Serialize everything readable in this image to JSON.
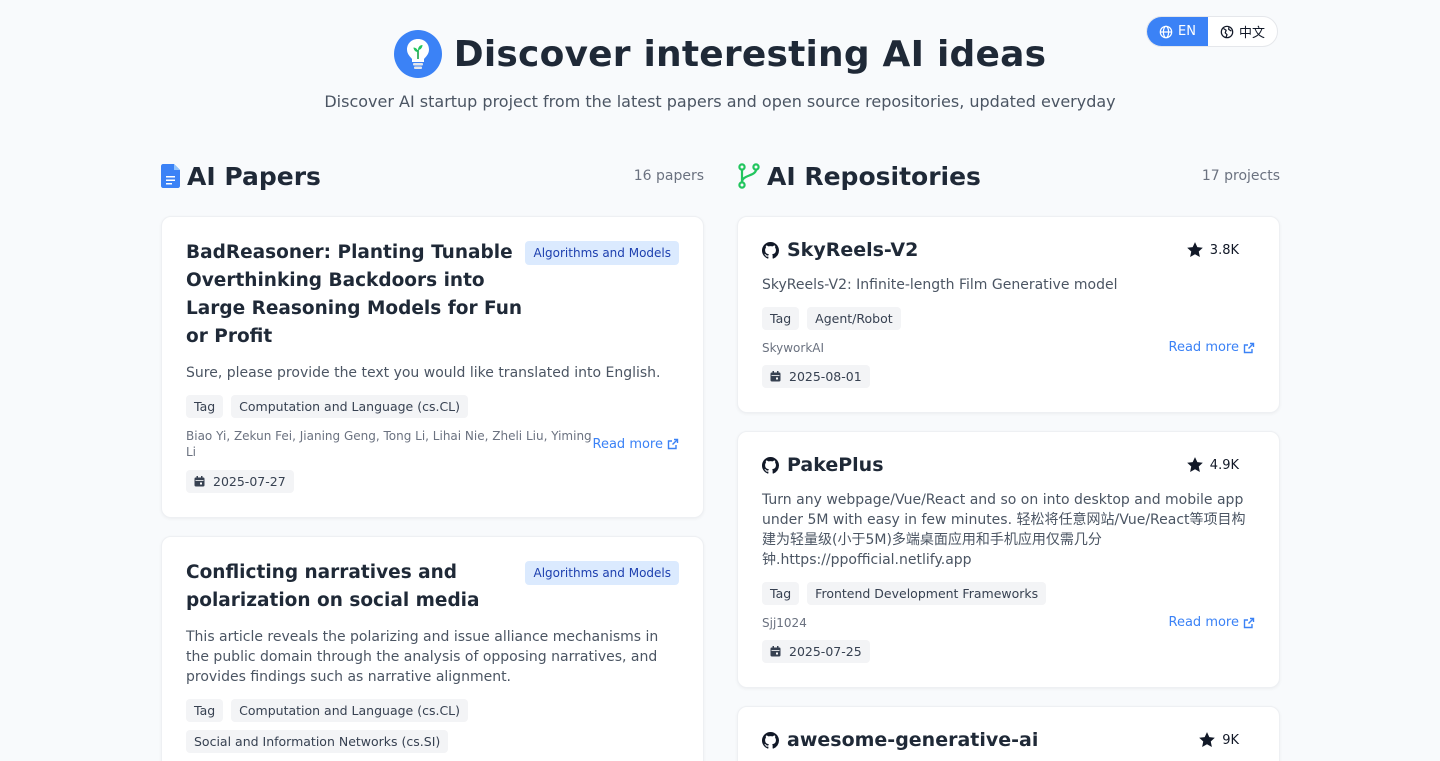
{
  "lang": {
    "en": "EN",
    "zh": "中文"
  },
  "hero": {
    "title": "Discover interesting AI ideas",
    "subtitle": "Discover AI startup project from the latest papers and open source repositories, updated everyday"
  },
  "papers": {
    "heading": "AI Papers",
    "count": "16 papers",
    "items": [
      {
        "title": "BadReasoner: Planting Tunable Overthinking Backdoors into Large Reasoning Models for Fun or Profit",
        "category": "Algorithms and Models",
        "description": "Sure, please provide the text you would like translated into English.",
        "tags": [
          "Tag",
          "Computation and Language (cs.CL)"
        ],
        "authors": "Biao Yi, Zekun Fei, Jianing Geng, Tong Li, Lihai Nie, Zheli Liu, Yiming Li",
        "read_more": "Read more",
        "date": "2025-07-27"
      },
      {
        "title": "Conflicting narratives and polarization on social media",
        "category": "Algorithms and Models",
        "description": "This article reveals the polarizing and issue alliance mechanisms in the public domain through the analysis of opposing narratives, and provides findings such as narrative alignment.",
        "tags": [
          "Tag",
          "Computation and Language (cs.CL)",
          "Social and Information Networks (cs.SI)"
        ]
      }
    ]
  },
  "repos": {
    "heading": "AI Repositories",
    "count": "17 projects",
    "items": [
      {
        "name": "SkyReels-V2",
        "stars": "3.8K",
        "description": "SkyReels-V2: Infinite-length Film Generative model",
        "tags": [
          "Tag",
          "Agent/Robot"
        ],
        "owner": "SkyworkAI",
        "read_more": "Read more",
        "date": "2025-08-01"
      },
      {
        "name": "PakePlus",
        "stars": "4.9K",
        "description": "Turn any webpage/Vue/React and so on into desktop and mobile app under 5M with easy in few minutes. 轻松将任意网站/Vue/React等项目构建为轻量级(小于5M)多端桌面应用和手机应用仅需几分钟.https://ppofficial.netlify.app",
        "tags": [
          "Tag",
          "Frontend Development Frameworks"
        ],
        "owner": "Sjj1024",
        "read_more": "Read more",
        "date": "2025-07-25"
      },
      {
        "name": "awesome-generative-ai",
        "stars": "9K"
      }
    ]
  },
  "colors": {
    "accent": "#3b82f6",
    "badge_bg": "#dbeafe",
    "badge_text": "#1e40af",
    "repo_icon": "#22c55e",
    "paper_icon": "#3b82f6"
  }
}
